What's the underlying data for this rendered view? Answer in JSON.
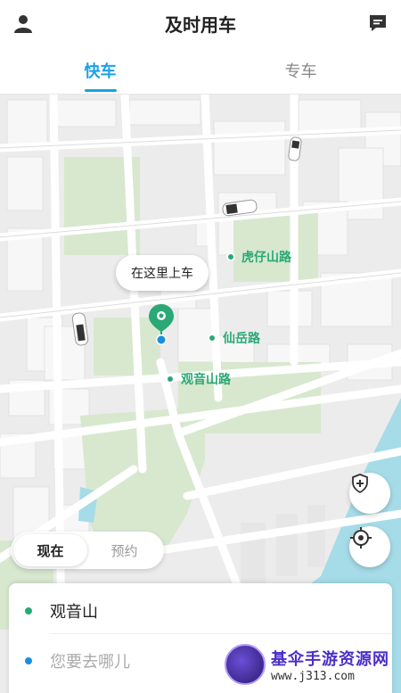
{
  "header": {
    "title": "及时用车"
  },
  "tabs": [
    {
      "label": "快车",
      "active": true
    },
    {
      "label": "专车",
      "active": false
    }
  ],
  "map": {
    "pickup_bubble": "在这里上车",
    "streets": [
      {
        "label": "虎仔山路"
      },
      {
        "label": "仙岳路"
      },
      {
        "label": "观音山路"
      }
    ]
  },
  "time_toggle": {
    "now": "现在",
    "reserve": "预约"
  },
  "location": {
    "from": "观音山",
    "to_placeholder": "您要去哪儿",
    "from_color": "#2aa876",
    "to_color": "#1a8fe0"
  },
  "watermark": {
    "title": "基伞手游资源网",
    "url": "www.j313.com"
  },
  "colors": {
    "accent": "#1aa1e8",
    "pin_green": "#2aa876",
    "park_green": "#d7e8cf",
    "water": "#a6dbe8"
  },
  "icons": {
    "user": "user-icon",
    "message": "message-icon",
    "safety": "shield-plus-icon",
    "locate": "locate-icon"
  }
}
